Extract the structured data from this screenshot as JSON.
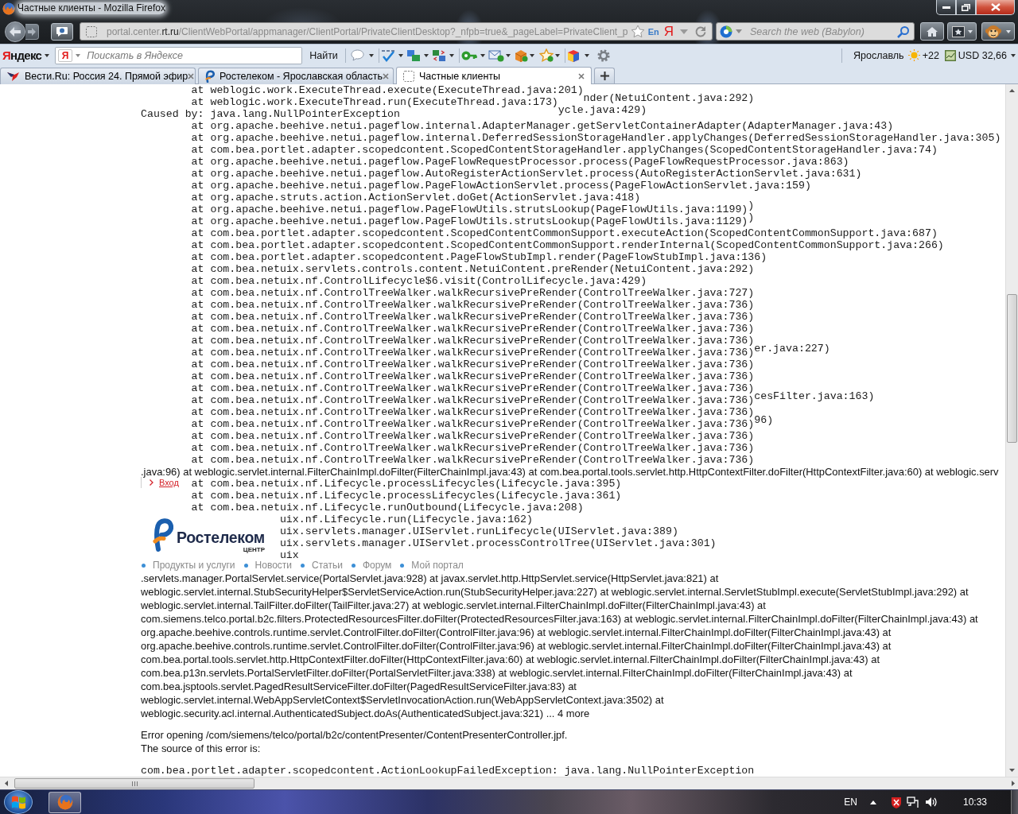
{
  "window": {
    "title": "Частные клиенты - Mozilla Firefox"
  },
  "nav_bar": {
    "url": {
      "subdomain": "portal.center.",
      "domain": "rt.ru",
      "path": "/ClientWebPortal/appmanager/ClientPortal/PrivateClientDesktop?_nfpb=true&_pageLabel=PrivateClient_p"
    },
    "translate_label": "En",
    "engine_letter": "Я",
    "search": {
      "placeholder": "Search the web (Babylon)"
    }
  },
  "toolbar": {
    "logo": "Яндекс",
    "search": {
      "badge": "Я",
      "placeholder": "Поискать в Яндексе"
    },
    "search_button": "Найти",
    "city": "Ярославль",
    "temperature": "+22",
    "currency": "USD 32,66"
  },
  "tabs": [
    {
      "title": "Вести.Ru: Россия 24. Прямой эфир",
      "selected": false
    },
    {
      "title": "Ростелеком - Ярославская область",
      "selected": false
    },
    {
      "title": "Частные клиенты",
      "selected": true
    }
  ],
  "page": {
    "trace_lines": [
      {
        "kind": "frame",
        "text": "at weblogic.work.ExecuteThread.execute(ExecuteThread.java:201)",
        "overprint": "nder(NetuiContent.java:292)"
      },
      {
        "kind": "frame",
        "text": "at weblogic.work.ExecuteThread.run(ExecuteThread.java:173)",
        "overprint": "ycle.java:429)"
      },
      {
        "kind": "cause",
        "text": "Caused by: java.lang.NullPointerException"
      },
      {
        "kind": "frame",
        "text": "at org.apache.beehive.netui.pageflow.internal.AdapterManager.getServletContainerAdapter(AdapterManager.java:43)"
      },
      {
        "kind": "frame",
        "text": "at org.apache.beehive.netui.pageflow.internal.DeferredSessionStorageHandler.applyChanges(DeferredSessionStorageHandler.java:305)"
      },
      {
        "kind": "frame",
        "text": "at com.bea.portlet.adapter.scopedcontent.ScopedContentStorageHandler.applyChanges(ScopedContentStorageHandler.java:74)"
      },
      {
        "kind": "frame",
        "text": "at org.apache.beehive.netui.pageflow.PageFlowRequestProcessor.process(PageFlowRequestProcessor.java:863)"
      },
      {
        "kind": "frame",
        "text": "at org.apache.beehive.netui.pageflow.AutoRegisterActionServlet.process(AutoRegisterActionServlet.java:631)"
      },
      {
        "kind": "frame",
        "text": "at org.apache.beehive.netui.pageflow.PageFlowActionServlet.process(PageFlowActionServlet.java:159)"
      },
      {
        "kind": "frame",
        "text": "at org.apache.struts.action.ActionServlet.doGet(ActionServlet.java:418)",
        "overprint": ")"
      },
      {
        "kind": "frame",
        "text": "at org.apache.beehive.netui.pageflow.PageFlowUtils.strutsLookup(PageFlowUtils.java:1199)",
        "overprint": ")"
      },
      {
        "kind": "frame",
        "text": "at org.apache.beehive.netui.pageflow.PageFlowUtils.strutsLookup(PageFlowUtils.java:1129)"
      },
      {
        "kind": "frame",
        "text": "at com.bea.portlet.adapter.scopedcontent.ScopedContentCommonSupport.executeAction(ScopedContentCommonSupport.java:687)"
      },
      {
        "kind": "frame",
        "text": "at com.bea.portlet.adapter.scopedcontent.ScopedContentCommonSupport.renderInternal(ScopedContentCommonSupport.java:266)"
      },
      {
        "kind": "frame",
        "text": "at com.bea.portlet.adapter.scopedcontent.PageFlowStubImpl.render(PageFlowStubImpl.java:136)"
      },
      {
        "kind": "frame",
        "text": "at com.bea.netuix.servlets.controls.content.NetuiContent.preRender(NetuiContent.java:292)"
      },
      {
        "kind": "frame",
        "text": "at com.bea.netuix.nf.ControlLifecycle$6.visit(ControlLifecycle.java:429)"
      },
      {
        "kind": "frame",
        "text": "at com.bea.netuix.nf.ControlTreeWalker.walkRecursivePreRender(ControlTreeWalker.java:727)"
      },
      {
        "kind": "frame",
        "text": "at com.bea.netuix.nf.ControlTreeWalker.walkRecursivePreRender(ControlTreeWalker.java:736)"
      },
      {
        "kind": "frame",
        "text": "at com.bea.netuix.nf.ControlTreeWalker.walkRecursivePreRender(ControlTreeWalker.java:736)"
      },
      {
        "kind": "frame",
        "text": "at com.bea.netuix.nf.ControlTreeWalker.walkRecursivePreRender(ControlTreeWalker.java:736)"
      },
      {
        "kind": "frame",
        "text": "at com.bea.netuix.nf.ControlTreeWalker.walkRecursivePreRender(ControlTreeWalker.java:736)",
        "overprint": "er.java:227)"
      },
      {
        "kind": "frame",
        "text": "at com.bea.netuix.nf.ControlTreeWalker.walkRecursivePreRender(ControlTreeWalker.java:736)"
      },
      {
        "kind": "frame",
        "text": "at com.bea.netuix.nf.ControlTreeWalker.walkRecursivePreRender(ControlTreeWalker.java:736)"
      },
      {
        "kind": "frame",
        "text": "at com.bea.netuix.nf.ControlTreeWalker.walkRecursivePreRender(ControlTreeWalker.java:736)"
      },
      {
        "kind": "frame",
        "text": "at com.bea.netuix.nf.ControlTreeWalker.walkRecursivePreRender(ControlTreeWalker.java:736)",
        "overprint": "cesFilter.java:163)"
      },
      {
        "kind": "frame",
        "text": "at com.bea.netuix.nf.ControlTreeWalker.walkRecursivePreRender(ControlTreeWalker.java:736)"
      },
      {
        "kind": "frame",
        "text": "at com.bea.netuix.nf.ControlTreeWalker.walkRecursivePreRender(ControlTreeWalker.java:736)",
        "overprint": "96)"
      },
      {
        "kind": "frame",
        "text": "at com.bea.netuix.nf.ControlTreeWalker.walkRecursivePreRender(ControlTreeWalker.java:736)"
      },
      {
        "kind": "frame",
        "text": "at com.bea.netuix.nf.ControlTreeWalker.walkRecursivePreRender(ControlTreeWalker.java:736)"
      },
      {
        "kind": "frame",
        "text": "at com.bea.netuix.nf.ControlTreeWalker.walkRecursivePreRender(ControlTreeWalker.java:736)"
      },
      {
        "kind": "frame",
        "text": "at com.bea.netuix.nf.ControlTreeWalker.walkRecursivePreRender(ControlTreeWalker.java:736)"
      },
      {
        "kind": "text",
        "text": ".java:96) at weblogic.servlet.internal.FilterChainImpl.doFilter(FilterChainImpl.java:43) at com.bea.portal.tools.servlet.http.HttpContextFilter.doFilter(HttpContextFilter.java:60) at weblogic.serv"
      },
      {
        "kind": "frame",
        "text": "at com.bea.netuix.nf.Lifecycle.processLifecycles(Lifecycle.java:395)"
      },
      {
        "kind": "frame",
        "text": "at com.bea.netuix.nf.Lifecycle.processLifecycles(Lifecycle.java:361)"
      },
      {
        "kind": "frame",
        "text": "at com.bea.netuix.nf.Lifecycle.runOutbound(Lifecycle.java:208)"
      }
    ],
    "trace_lines_beside_logo": [
      "uix.nf.Lifecycle.run(Lifecycle.java:162)",
      "uix.servlets.manager.UIServlet.runLifecycle(UIServlet.java:389)",
      "uix.servlets.manager.UIServlet.processControlTree(UIServlet.java:301)",
      "uix"
    ],
    "login_link": "Вход",
    "logo": {
      "name": "Ростелеком",
      "region": "ЦЕНТР"
    },
    "nav_links": [
      "Продукты и услуги",
      "Новости",
      "Статьи",
      "Форум",
      "Мой портал"
    ],
    "trace_paragraph": [
      ".servlets.manager.PortalServlet.service(PortalServlet.java:928) at javax.servlet.http.HttpServlet.service(HttpServlet.java:821) at",
      "weblogic.servlet.internal.StubSecurityHelper$ServletServiceAction.run(StubSecurityHelper.java:227) at weblogic.servlet.internal.ServletStubImpl.execute(ServletStubImpl.java:292) at",
      "weblogic.servlet.internal.TailFilter.doFilter(TailFilter.java:27) at weblogic.servlet.internal.FilterChainImpl.doFilter(FilterChainImpl.java:43) at",
      "com.siemens.telco.portal.b2c.filters.ProtectedResourcesFilter.doFilter(ProtectedResourcesFilter.java:163) at weblogic.servlet.internal.FilterChainImpl.doFilter(FilterChainImpl.java:43) at",
      "org.apache.beehive.controls.runtime.servlet.ControlFilter.doFilter(ControlFilter.java:96) at weblogic.servlet.internal.FilterChainImpl.doFilter(FilterChainImpl.java:43) at",
      "org.apache.beehive.controls.runtime.servlet.ControlFilter.doFilter(ControlFilter.java:96) at weblogic.servlet.internal.FilterChainImpl.doFilter(FilterChainImpl.java:43) at",
      "com.bea.portal.tools.servlet.http.HttpContextFilter.doFilter(HttpContextFilter.java:60) at weblogic.servlet.internal.FilterChainImpl.doFilter(FilterChainImpl.java:43) at",
      "com.bea.p13n.servlets.PortalServletFilter.doFilter(PortalServletFilter.java:338) at weblogic.servlet.internal.FilterChainImpl.doFilter(FilterChainImpl.java:43) at",
      "com.bea.jsptools.servlet.PagedResultServiceFilter.doFilter(PagedResultServiceFilter.java:83) at",
      "weblogic.servlet.internal.WebAppServletContext$ServletInvocationAction.run(WebAppServletContext.java:3502) at",
      "weblogic.security.acl.internal.AuthenticatedSubject.doAs(AuthenticatedSubject.java:321) ... 4 more"
    ],
    "error_message": "Error opening /com/siemens/telco/portal/b2c/contentPresenter/ContentPresenterController.jpf.",
    "error_source_label": "The source of this error is:",
    "exception": "com.bea.portlet.adapter.scopedcontent.ActionLookupFailedException: java.lang.NullPointerException"
  },
  "taskbar": {
    "language": "EN",
    "clock": "10:33"
  }
}
